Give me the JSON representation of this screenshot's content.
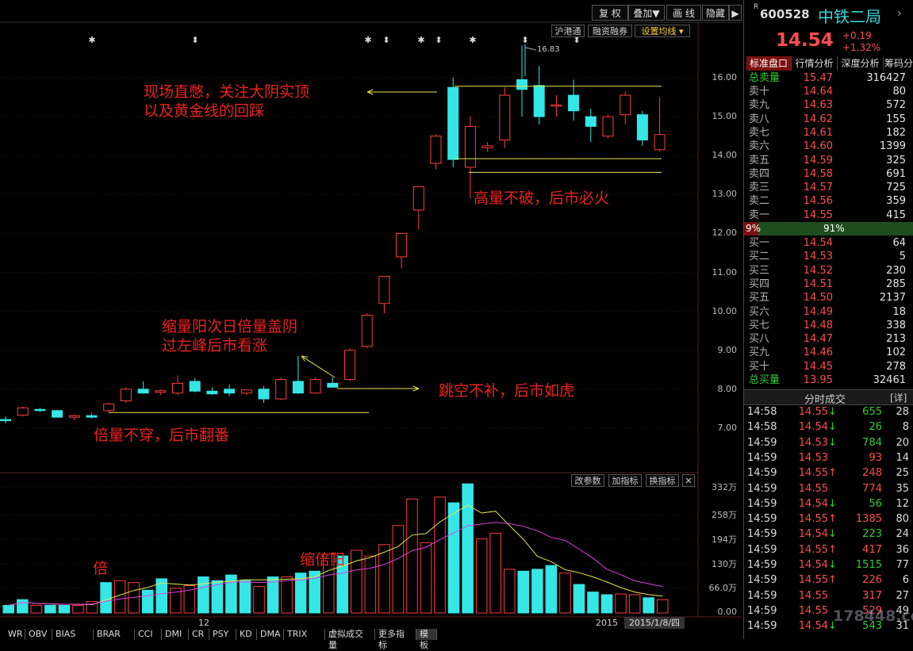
{
  "toolbar": {
    "restore_rights": "复 权",
    "overlay": "叠加▼",
    "draw_line": "画 线",
    "hide": "隐藏",
    "hk_connect": "沪港通",
    "margin": "融资融券",
    "ma_settings": "设置均线"
  },
  "stock": {
    "code": "600528",
    "name": "中铁二局",
    "price": "14.54",
    "change": "+0.19",
    "change_pct": "+1.32%",
    "r_mark": "R"
  },
  "right_tabs": [
    "标准盘口",
    "行情分析",
    "深度分析",
    "筹码分"
  ],
  "order_book": {
    "total_sell_label": "总卖量",
    "total_sell_price": "15.47",
    "total_sell_vol": "316427",
    "asks": [
      {
        "label": "卖十",
        "price": "14.64",
        "vol": "80"
      },
      {
        "label": "卖九",
        "price": "14.63",
        "vol": "572"
      },
      {
        "label": "卖八",
        "price": "14.62",
        "vol": "155"
      },
      {
        "label": "卖七",
        "price": "14.61",
        "vol": "182"
      },
      {
        "label": "卖六",
        "price": "14.60",
        "vol": "1399"
      },
      {
        "label": "卖五",
        "price": "14.59",
        "vol": "325"
      },
      {
        "label": "卖四",
        "price": "14.58",
        "vol": "691"
      },
      {
        "label": "卖三",
        "price": "14.57",
        "vol": "725"
      },
      {
        "label": "卖二",
        "price": "14.56",
        "vol": "359"
      },
      {
        "label": "卖一",
        "price": "14.55",
        "vol": "415"
      }
    ],
    "ratio_left": "9%",
    "ratio_right": "91%",
    "bids": [
      {
        "label": "买一",
        "price": "14.54",
        "vol": "64"
      },
      {
        "label": "买二",
        "price": "14.53",
        "vol": "5"
      },
      {
        "label": "买三",
        "price": "14.52",
        "vol": "230"
      },
      {
        "label": "买四",
        "price": "14.51",
        "vol": "285"
      },
      {
        "label": "买五",
        "price": "14.50",
        "vol": "2137"
      },
      {
        "label": "买六",
        "price": "14.49",
        "vol": "18"
      },
      {
        "label": "买七",
        "price": "14.48",
        "vol": "338"
      },
      {
        "label": "买八",
        "price": "14.47",
        "vol": "213"
      },
      {
        "label": "买九",
        "price": "14.46",
        "vol": "102"
      },
      {
        "label": "买十",
        "price": "14.45",
        "vol": "278"
      }
    ],
    "total_buy_label": "总买量",
    "total_buy_price": "13.95",
    "total_buy_vol": "32461"
  },
  "trades_header": {
    "title": "分时成交",
    "detail": "[详]"
  },
  "trades": [
    {
      "time": "14:58",
      "price": "14.55",
      "dir": "down",
      "vol": "655",
      "n": "28"
    },
    {
      "time": "14:58",
      "price": "14.54",
      "dir": "down",
      "vol": "26",
      "n": "8"
    },
    {
      "time": "14:59",
      "price": "14.53",
      "dir": "down",
      "vol": "784",
      "n": "20"
    },
    {
      "time": "14:59",
      "price": "14.53",
      "dir": "",
      "vol": "93",
      "n": "14"
    },
    {
      "time": "14:59",
      "price": "14.55",
      "dir": "up",
      "vol": "248",
      "n": "25"
    },
    {
      "time": "14:59",
      "price": "14.55",
      "dir": "",
      "vol": "774",
      "n": "35"
    },
    {
      "time": "14:59",
      "price": "14.54",
      "dir": "down",
      "vol": "56",
      "n": "12"
    },
    {
      "time": "14:59",
      "price": "14.55",
      "dir": "up",
      "vol": "1385",
      "n": "80"
    },
    {
      "time": "14:59",
      "price": "14.54",
      "dir": "down",
      "vol": "223",
      "n": "24"
    },
    {
      "time": "14:59",
      "price": "14.55",
      "dir": "up",
      "vol": "417",
      "n": "36"
    },
    {
      "time": "14:59",
      "price": "14.54",
      "dir": "down",
      "vol": "1515",
      "n": "77"
    },
    {
      "time": "14:59",
      "price": "14.55",
      "dir": "up",
      "vol": "226",
      "n": "6"
    },
    {
      "time": "14:59",
      "price": "14.55",
      "dir": "",
      "vol": "317",
      "n": "27"
    },
    {
      "time": "14:59",
      "price": "14.55",
      "dir": "",
      "vol": "529",
      "n": "49"
    },
    {
      "time": "14:59",
      "price": "14.54",
      "dir": "down",
      "vol": "543",
      "n": "31"
    }
  ],
  "annotations": {
    "top1": "现场直憋，关注大阴实顶",
    "top2": "以及黄金线的回踩",
    "hold": "高量不破，后市必火",
    "shrink1": "缩量阳次日倍量盖阴",
    "shrink2": "过左峰后市看涨",
    "gap": "跳空不补，后市如虎",
    "double": "倍量不穿，后市翻番",
    "vol_bei": "倍",
    "vol_shrink": "缩倍阳"
  },
  "volume_panel": {
    "change_params": "改参数",
    "add_indicator": "加指标",
    "switch_indicator": "换指标",
    "close": "✕"
  },
  "bottom_tabs": [
    "WR",
    "OBV",
    "BIAS",
    "BRAR",
    "CCI",
    "DMI",
    "CR",
    "PSY",
    "KD",
    "DMA",
    "TRIX",
    "虚拟成交量",
    "更多指标",
    "模板"
  ],
  "axis": {
    "x_label_12": "12",
    "x_label_2015": "2015",
    "date_readout": "2015/1/8/四",
    "high_mark": "16.83"
  },
  "watermark": "178448.com",
  "chart_data": {
    "type": "candlestick",
    "price_ticks": [
      "16.00",
      "15.00",
      "14.00",
      "13.00",
      "12.00",
      "11.00",
      "10.00",
      "9.00",
      "8.00",
      "7.00"
    ],
    "volume_ticks": [
      "332万",
      "258万",
      "194万",
      "130万",
      "66.0万",
      "0.00"
    ],
    "candles": [
      {
        "o": 7.22,
        "h": 7.3,
        "l": 7.12,
        "c": 7.2
      },
      {
        "o": 7.33,
        "h": 7.55,
        "l": 7.3,
        "c": 7.52
      },
      {
        "o": 7.48,
        "h": 7.52,
        "l": 7.42,
        "c": 7.46
      },
      {
        "o": 7.45,
        "h": 7.47,
        "l": 7.28,
        "c": 7.28
      },
      {
        "o": 7.28,
        "h": 7.35,
        "l": 7.2,
        "c": 7.32
      },
      {
        "o": 7.32,
        "h": 7.38,
        "l": 7.25,
        "c": 7.28
      },
      {
        "o": 7.45,
        "h": 7.65,
        "l": 7.4,
        "c": 7.62
      },
      {
        "o": 7.7,
        "h": 8.05,
        "l": 7.65,
        "c": 8.0
      },
      {
        "o": 8.0,
        "h": 8.2,
        "l": 7.88,
        "c": 7.9
      },
      {
        "o": 7.92,
        "h": 8.0,
        "l": 7.85,
        "c": 7.96
      },
      {
        "o": 7.9,
        "h": 8.35,
        "l": 7.85,
        "c": 8.15
      },
      {
        "o": 8.2,
        "h": 8.28,
        "l": 7.92,
        "c": 7.95
      },
      {
        "o": 7.95,
        "h": 8.05,
        "l": 7.85,
        "c": 7.88
      },
      {
        "o": 8.0,
        "h": 8.12,
        "l": 7.82,
        "c": 7.9
      },
      {
        "o": 7.9,
        "h": 8.0,
        "l": 7.85,
        "c": 7.98
      },
      {
        "o": 8.0,
        "h": 8.08,
        "l": 7.65,
        "c": 7.75
      },
      {
        "o": 7.75,
        "h": 8.3,
        "l": 7.72,
        "c": 8.25
      },
      {
        "o": 8.2,
        "h": 8.85,
        "l": 7.88,
        "c": 7.9
      },
      {
        "o": 7.9,
        "h": 8.3,
        "l": 7.88,
        "c": 8.25
      },
      {
        "o": 8.15,
        "h": 8.3,
        "l": 8.05,
        "c": 8.05
      },
      {
        "o": 8.25,
        "h": 9.05,
        "l": 8.2,
        "c": 9.0
      },
      {
        "o": 9.1,
        "h": 9.95,
        "l": 9.05,
        "c": 9.9
      },
      {
        "o": 10.2,
        "h": 10.9,
        "l": 9.95,
        "c": 10.9
      },
      {
        "o": 11.4,
        "h": 12.0,
        "l": 11.1,
        "c": 12.0
      },
      {
        "o": 12.6,
        "h": 13.2,
        "l": 12.1,
        "c": 13.2
      },
      {
        "o": 13.8,
        "h": 14.55,
        "l": 13.65,
        "c": 14.5
      },
      {
        "o": 15.75,
        "h": 16.0,
        "l": 13.7,
        "c": 13.9
      },
      {
        "o": 13.7,
        "h": 15.0,
        "l": 12.9,
        "c": 14.75
      },
      {
        "o": 14.2,
        "h": 14.35,
        "l": 14.1,
        "c": 14.25
      },
      {
        "o": 14.4,
        "h": 15.75,
        "l": 14.2,
        "c": 15.55
      },
      {
        "o": 15.95,
        "h": 16.83,
        "l": 15.0,
        "c": 15.7
      },
      {
        "o": 15.8,
        "h": 16.3,
        "l": 14.8,
        "c": 15.0
      },
      {
        "o": 15.3,
        "h": 15.55,
        "l": 15.0,
        "c": 15.3
      },
      {
        "o": 15.55,
        "h": 15.95,
        "l": 14.9,
        "c": 15.15
      },
      {
        "o": 15.0,
        "h": 15.2,
        "l": 14.35,
        "c": 14.75
      },
      {
        "o": 14.5,
        "h": 15.05,
        "l": 14.45,
        "c": 15.0
      },
      {
        "o": 15.05,
        "h": 15.65,
        "l": 14.8,
        "c": 15.55
      },
      {
        "o": 15.05,
        "h": 15.15,
        "l": 14.25,
        "c": 14.4
      },
      {
        "o": 14.15,
        "h": 15.5,
        "l": 14.1,
        "c": 14.54
      }
    ],
    "volumes": [
      20,
      35,
      20,
      20,
      20,
      20,
      30,
      80,
      85,
      80,
      60,
      90,
      65,
      72,
      95,
      85,
      100,
      85,
      70,
      95,
      95,
      105,
      110,
      155,
      150,
      165,
      150,
      180,
      230,
      300,
      185,
      305,
      290,
      340,
      195,
      210,
      115,
      110,
      115,
      125,
      105,
      75,
      55,
      48,
      50,
      48,
      40,
      35
    ]
  }
}
